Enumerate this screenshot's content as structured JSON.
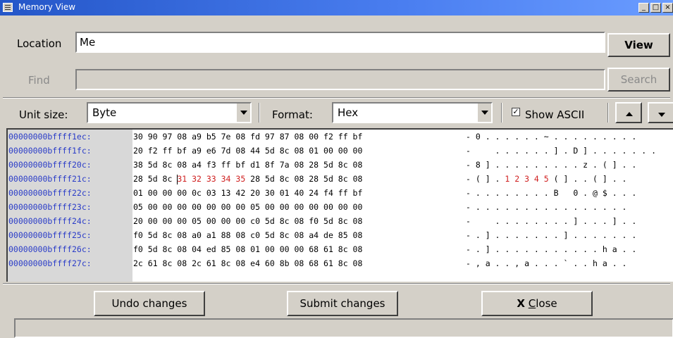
{
  "window": {
    "title": "Memory View"
  },
  "location": {
    "label": "Location",
    "value": "Me",
    "view_button": "View"
  },
  "find": {
    "label": "Find",
    "value": "",
    "search_button": "Search"
  },
  "options": {
    "unit_label": "Unit size:",
    "unit_value": "Byte",
    "format_label": "Format:",
    "format_value": "Hex",
    "show_ascii_label": "Show ASCII",
    "show_ascii_checked": true,
    "show_ascii_check_glyph": "✓"
  },
  "memory": {
    "rows": [
      {
        "addr": "00000000bffff1ec:",
        "hex_pre": "30 90 97 08 a9 b5 7e 08 fd 97 87 08 00 f2 ff bf",
        "hex_mod": "",
        "hex_post": "",
        "asc_pre": "- 0 . . . . . . ~ . . . . . . . . .",
        "asc_mod": "",
        "asc_post": ""
      },
      {
        "addr": "00000000bffff1fc:",
        "hex_pre": "20 f2 ff bf a9 e6 7d 08 44 5d 8c 08 01 00 00 00",
        "hex_mod": "",
        "hex_post": "",
        "asc_pre": "-     . . . . . . ] . D ] . . . . . . .",
        "asc_mod": "",
        "asc_post": ""
      },
      {
        "addr": "00000000bffff20c:",
        "hex_pre": "38 5d 8c 08 a4 f3 ff bf d1 8f 7a 08 28 5d 8c 08",
        "hex_mod": "",
        "hex_post": "",
        "asc_pre": "- 8 ] . . . . . . . . . z . ( ] . .",
        "asc_mod": "",
        "asc_post": ""
      },
      {
        "addr": "00000000bffff21c:",
        "hex_pre": "28 5d 8c ",
        "hex_mod": "31 32 33 34 35",
        "hex_post": " 28 5d 8c 08 28 5d 8c 08",
        "asc_pre": "- ( ] . ",
        "asc_mod": "1 2 3 4 5",
        "asc_post": " ( ] . . ( ] . ."
      },
      {
        "addr": "00000000bffff22c:",
        "hex_pre": "01 00 00 00 0c 03 13 42 20 30 01 40 24 f4 ff bf",
        "hex_mod": "",
        "hex_post": "",
        "asc_pre": "- . . . . . . . . B   0 . @ $ . . .",
        "asc_mod": "",
        "asc_post": ""
      },
      {
        "addr": "00000000bffff23c:",
        "hex_pre": "05 00 00 00 00 00 00 00 05 00 00 00 00 00 00 00",
        "hex_mod": "",
        "hex_post": "",
        "asc_pre": "- . . . . . . . . . . . . . . . .",
        "asc_mod": "",
        "asc_post": ""
      },
      {
        "addr": "00000000bffff24c:",
        "hex_pre": "20 00 00 00 05 00 00 00 c0 5d 8c 08 f0 5d 8c 08",
        "hex_mod": "",
        "hex_post": "",
        "asc_pre": "-     . . . . . . . . ] . . . ] . .",
        "asc_mod": "",
        "asc_post": ""
      },
      {
        "addr": "00000000bffff25c:",
        "hex_pre": "f0 5d 8c 08 a0 a1 88 08 c0 5d 8c 08 a4 de 85 08",
        "hex_mod": "",
        "hex_post": "",
        "asc_pre": "- . ] . . . . . . . ] . . . . . . .",
        "asc_mod": "",
        "asc_post": ""
      },
      {
        "addr": "00000000bffff26c:",
        "hex_pre": "f0 5d 8c 08 04 ed 85 08 01 00 00 00 68 61 8c 08",
        "hex_mod": "",
        "hex_post": "",
        "asc_pre": "- . ] . . . . . . . . . . . h a . .",
        "asc_mod": "",
        "asc_post": ""
      },
      {
        "addr": "00000000bffff27c:",
        "hex_pre": "2c 61 8c 08 2c 61 8c 08 e4 60 8b 08 68 61 8c 08",
        "hex_mod": "",
        "hex_post": "",
        "asc_pre": "- , a . . , a . . . ` . . h a . .",
        "asc_mod": "",
        "asc_post": ""
      }
    ]
  },
  "buttons": {
    "undo": "Undo changes",
    "submit": "Submit changes",
    "close_icon": "X",
    "close_mnemonic": "C",
    "close_rest": "lose"
  },
  "titlebar_buttons": {
    "minimize": "_",
    "maximize": "□",
    "close": "×"
  },
  "colors": {
    "address": "#2a3cc8",
    "modified": "#d02020",
    "titlebar": "#2456c8"
  }
}
